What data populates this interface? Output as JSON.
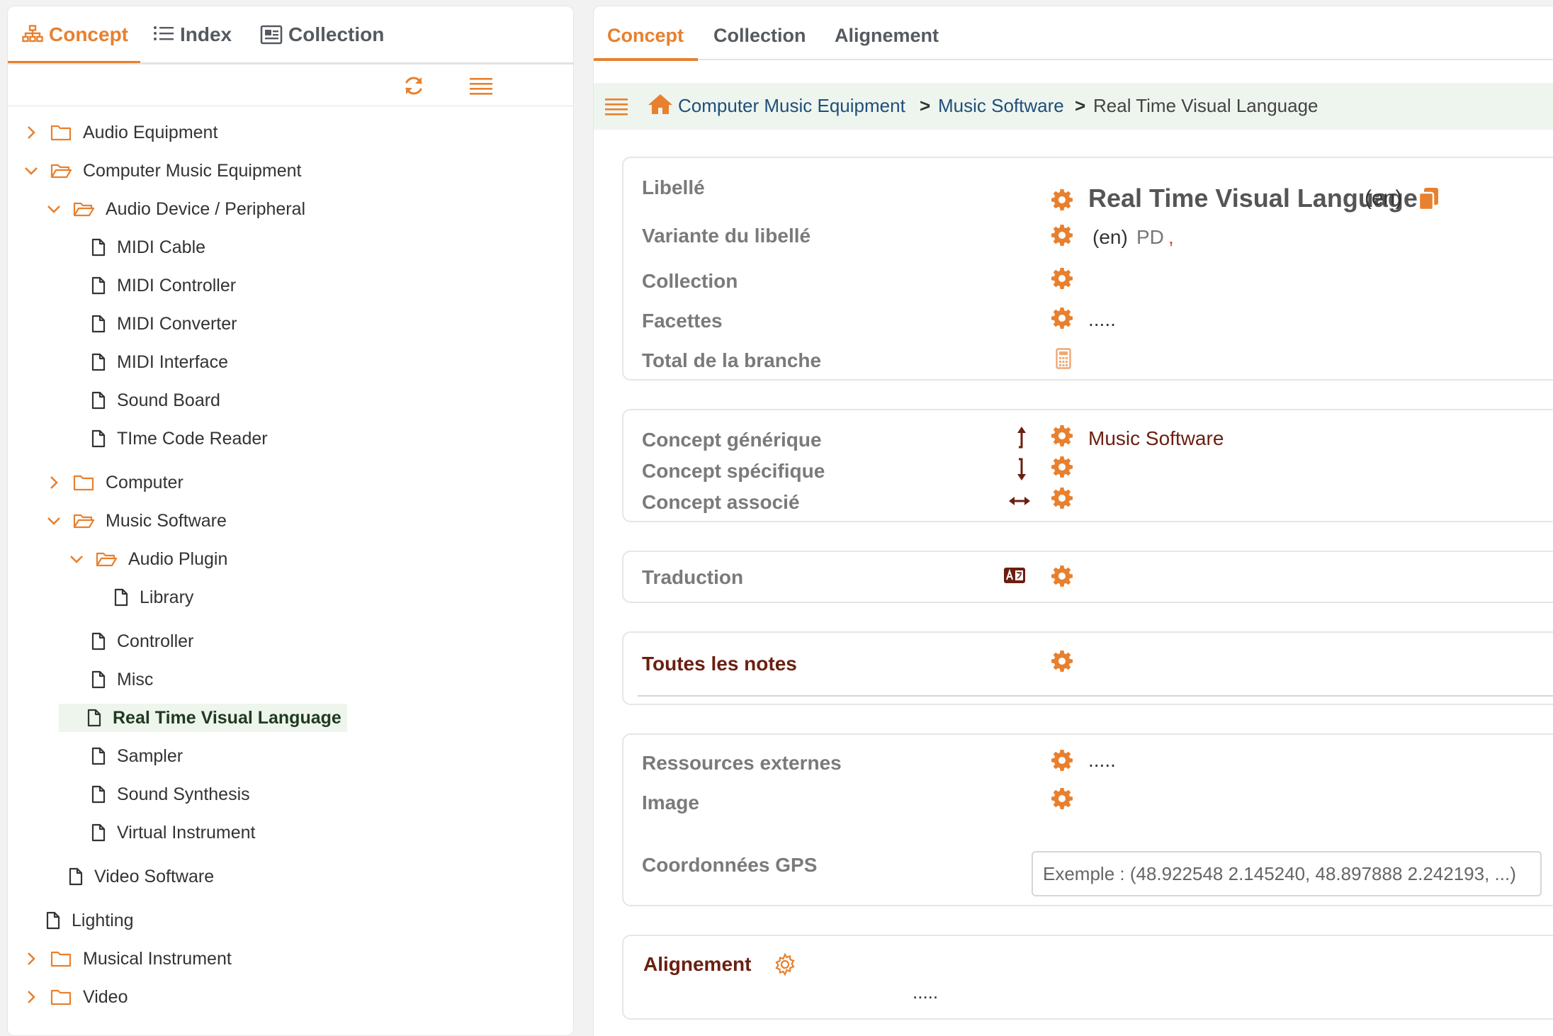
{
  "left_tabs": {
    "concept": "Concept",
    "index": "Index",
    "collection": "Collection"
  },
  "tree": [
    {
      "label": "Audio Equipment",
      "type": "folder",
      "expanded": false
    },
    {
      "label": "Computer Music Equipment",
      "type": "folder",
      "expanded": true
    },
    {
      "label": "Audio Device / Peripheral",
      "type": "folder",
      "expanded": true
    },
    {
      "label": "MIDI Cable",
      "type": "leaf"
    },
    {
      "label": "MIDI Controller",
      "type": "leaf"
    },
    {
      "label": "MIDI Converter",
      "type": "leaf"
    },
    {
      "label": "MIDI Interface",
      "type": "leaf"
    },
    {
      "label": "Sound Board",
      "type": "leaf"
    },
    {
      "label": "TIme Code Reader",
      "type": "leaf"
    },
    {
      "label": "Computer",
      "type": "folder",
      "expanded": false
    },
    {
      "label": "Music Software",
      "type": "folder",
      "expanded": true
    },
    {
      "label": "Audio Plugin",
      "type": "folder",
      "expanded": true
    },
    {
      "label": "Library",
      "type": "leaf"
    },
    {
      "label": "Controller",
      "type": "leaf"
    },
    {
      "label": "Misc",
      "type": "leaf"
    },
    {
      "label": "Real Time Visual Language",
      "type": "leaf",
      "selected": true
    },
    {
      "label": "Sampler",
      "type": "leaf"
    },
    {
      "label": "Sound Synthesis",
      "type": "leaf"
    },
    {
      "label": "Virtual Instrument",
      "type": "leaf"
    },
    {
      "label": "Video Software",
      "type": "leaf"
    },
    {
      "label": "Lighting",
      "type": "leaf"
    },
    {
      "label": "Musical Instrument",
      "type": "folder",
      "expanded": false
    },
    {
      "label": "Video",
      "type": "folder",
      "expanded": false
    }
  ],
  "right_tabs": {
    "concept": "Concept",
    "collection": "Collection",
    "alignment": "Alignement"
  },
  "breadcrumb": {
    "item1": "Computer Music Equipment",
    "sep1": ">",
    "item2": "Music Software",
    "sep2": ">",
    "current": "Real Time Visual Language"
  },
  "card1": {
    "label_libelle": "Libellé",
    "pref_label": "Real Time Visual Language",
    "pref_lang": "(en)",
    "label_variante": "Variante du libellé",
    "alt_lang": "(en)",
    "alt_value": "PD",
    "alt_sep": ",",
    "label_collection": "Collection",
    "label_facettes": "Facettes",
    "facettes_value": ".....",
    "label_total": "Total de la branche"
  },
  "card2": {
    "label_generique": "Concept générique",
    "generique_value": "Music Software",
    "label_specifique": "Concept spécifique",
    "label_associe": "Concept associé"
  },
  "card3": {
    "label_traduction": "Traduction"
  },
  "card4": {
    "label_notes": "Toutes les notes"
  },
  "card5": {
    "label_ressources": "Ressources externes",
    "ressources_value": ".....",
    "label_image": "Image",
    "label_gps": "Coordonnées GPS",
    "gps_placeholder": "Exemple : (48.922548 2.145240, 48.897888 2.242193, ...)"
  },
  "card6": {
    "label_alignement": "Alignement",
    "alignement_value": "....."
  },
  "colors": {
    "accent": "#e8802e",
    "dark_red": "#6b1f10",
    "link": "#1f4e79",
    "selected_bg": "#eef5ec"
  }
}
